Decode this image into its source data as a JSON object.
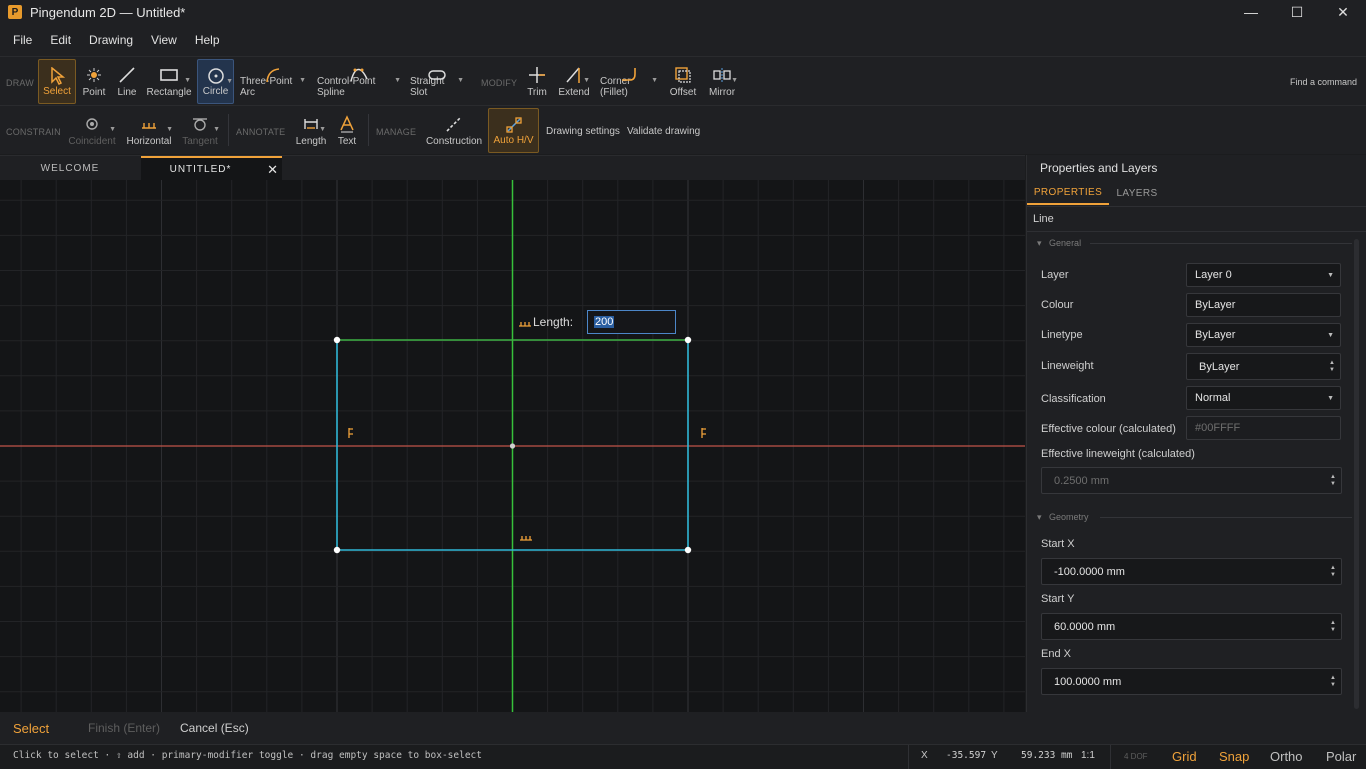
{
  "window": {
    "title": "Pingendum 2D — Untitled*",
    "logo_letter": "P",
    "minimize": "—",
    "maximize": "☐",
    "close": "✕"
  },
  "menu": [
    "File",
    "Edit",
    "Drawing",
    "View",
    "Help"
  ],
  "toolbar": {
    "draw_label": "DRAW",
    "modify_label": "MODIFY",
    "find_command": "Find a command",
    "tools": {
      "select": "Select",
      "point": "Point",
      "line": "Line",
      "rectangle": "Rectangle",
      "circle": "Circle",
      "three_point_arc": "Three-Point Arc",
      "control_point_spline": "Control-Point Spline",
      "straight_slot": "Straight Slot",
      "trim": "Trim",
      "extend": "Extend",
      "corner_fillet": "Corner (Fillet)",
      "offset": "Offset",
      "mirror": "Mirror"
    }
  },
  "toolbar2": {
    "constrain_label": "CONSTRAIN",
    "annotate_label": "ANNOTATE",
    "manage_label": "MANAGE",
    "coincident": "Coincident",
    "horizontal": "Horizontal",
    "tangent": "Tangent",
    "length": "Length",
    "text": "Text",
    "construction": "Construction",
    "auto_hv": "Auto H/V",
    "drawing_settings": "Drawing settings",
    "validate_drawing": "Validate drawing"
  },
  "tabs": {
    "welcome": "WELCOME",
    "untitled": "UNTITLED*",
    "close": "✕"
  },
  "canvas": {
    "length_label": "Length:",
    "length_value": "200"
  },
  "panel": {
    "title": "Properties and Layers",
    "tab_properties": "PROPERTIES",
    "tab_layers": "LAYERS",
    "object_type": "Line",
    "section_general": "General",
    "section_geometry": "Geometry",
    "layer_label": "Layer",
    "layer_value": "Layer 0",
    "colour_label": "Colour",
    "colour_value": "ByLayer",
    "linetype_label": "Linetype",
    "linetype_value": "ByLayer",
    "lineweight_label": "Lineweight",
    "lineweight_value": "ByLayer",
    "classification_label": "Classification",
    "classification_value": "Normal",
    "eff_colour_label": "Effective colour (calculated)",
    "eff_colour_value": "#00FFFF",
    "eff_lineweight_label": "Effective lineweight (calculated)",
    "eff_lineweight_value": "0.2500 mm",
    "start_x_label": "Start X",
    "start_x_value": "-100.0000 mm",
    "start_y_label": "Start Y",
    "start_y_value": "60.0000 mm",
    "end_x_label": "End X",
    "end_x_value": "100.0000 mm"
  },
  "command_bar": {
    "select": "Select",
    "finish": "Finish (Enter)",
    "cancel": "Cancel (Esc)"
  },
  "status": {
    "hint": "Click to select · ⇧ add · primary-modifier toggle · drag empty space to box-select",
    "x_label": "X",
    "x_value": "-35.597",
    "y_label": "Y",
    "y_value": "59.233 mm",
    "scale": "1:1",
    "dof": "4 DOF",
    "grid": "Grid",
    "snap": "Snap",
    "ortho": "Ortho",
    "polar": "Polar"
  },
  "colors": {
    "accent": "#f0a23a",
    "x_axis": "#c0544a",
    "y_axis": "#37c13a",
    "cyan_lines": "#2fb7d6",
    "green_line": "#3cb043"
  }
}
